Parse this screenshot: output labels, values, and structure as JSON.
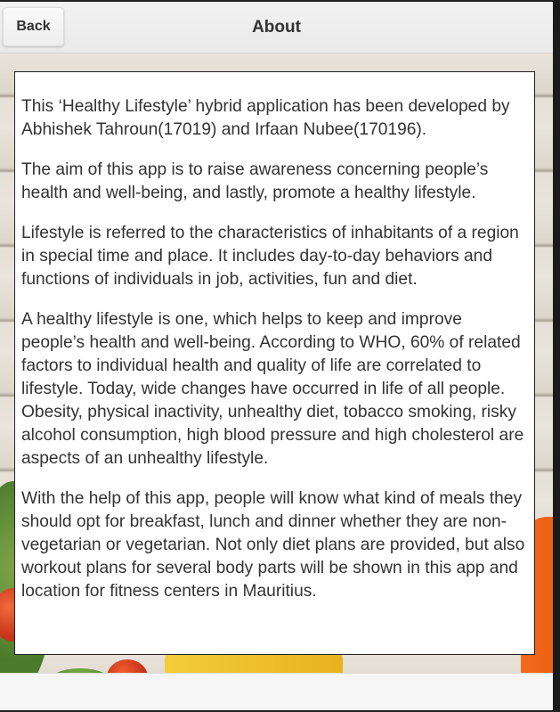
{
  "header": {
    "back_label": "Back",
    "title": "About"
  },
  "content": {
    "paragraphs": [
      "This ‘Healthy Lifestyle’ hybrid application has been developed by Abhishek Tahroun(17019) and Irfaan Nubee(170196).",
      "The aim of this app is to raise awareness concerning people’s health and well-being, and lastly, promote a healthy lifestyle.",
      "Lifestyle is referred to the characteristics of inhabitants of a region in special time and place. It includes day-to-day behaviors and functions of individuals in job, activities, fun and diet.",
      "A healthy lifestyle is one, which helps to keep and improve people’s health and well-being. According to WHO, 60% of related factors to individual health and quality of life are correlated to lifestyle. Today, wide changes have occurred in life of all people. Obesity, physical inactivity, unhealthy diet, tobacco smoking, risky alcohol consumption, high blood pressure and high cholesterol are aspects of an unhealthy lifestyle.",
      "With the help of this app, people will know what kind of meals they should opt for breakfast, lunch and dinner whether they are non-vegetarian or vegetarian. Not only diet plans are provided, but also workout plans for several body parts will be shown in this app and location for fitness centers in Mauritius."
    ]
  }
}
